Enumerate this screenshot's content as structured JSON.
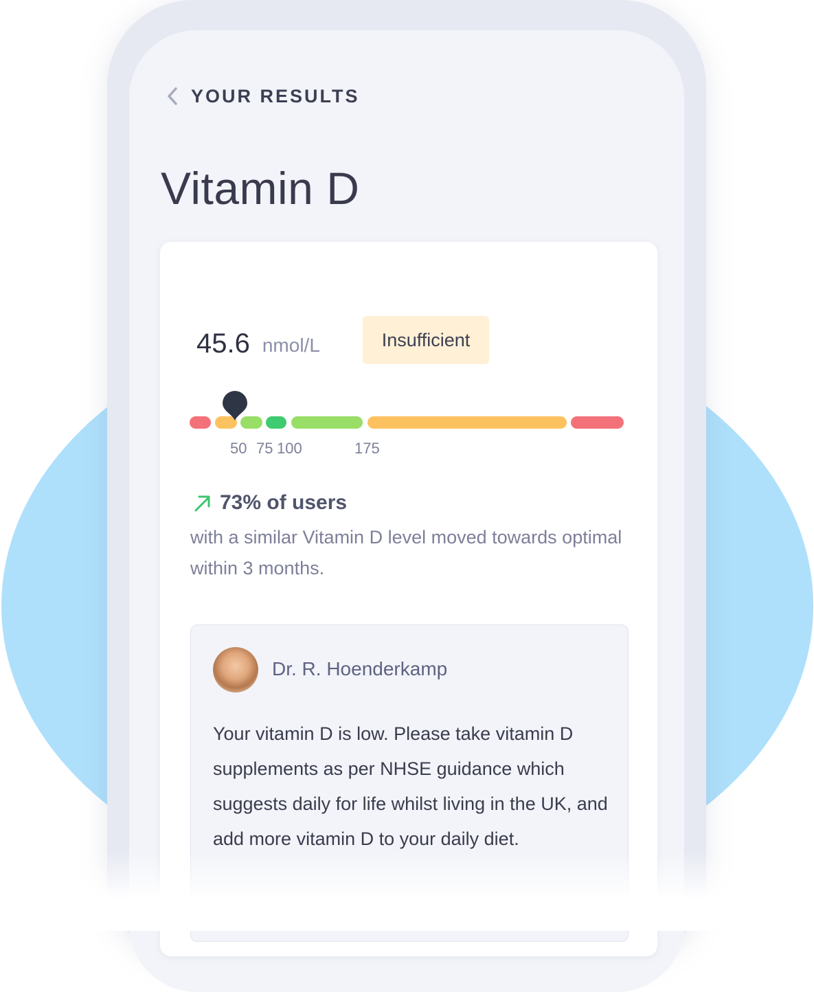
{
  "header": {
    "back_label": "YOUR RESULTS"
  },
  "page": {
    "title": "Vitamin D"
  },
  "result": {
    "value": "45.6",
    "unit": "nmol/L",
    "status": "Insufficient",
    "colors": {
      "badge_bg": "#fff0d6",
      "red": "#f3727a",
      "orange": "#fdc260",
      "light_green": "#99de67",
      "dark_green": "#3fcb6f",
      "marker": "#2e3545"
    }
  },
  "range": {
    "ticks": [
      "50",
      "75",
      "100",
      "175"
    ],
    "segment_colors": [
      "red",
      "orange",
      "light_green",
      "dark_green",
      "light_green",
      "orange",
      "red"
    ],
    "marker_value": 45.6
  },
  "trend": {
    "icon": "arrow-up-right-icon",
    "title": "73% of users",
    "description": "with a similar Vitamin D level moved towards optimal within 3 months."
  },
  "doctor": {
    "name": "Dr. R. Hoenderkamp",
    "message": "Your vitamin D is low.  Please take vitamin D supplements as per NHSE guidance which suggests daily for life whilst living in the UK, and add more vitamin D to your daily diet."
  }
}
